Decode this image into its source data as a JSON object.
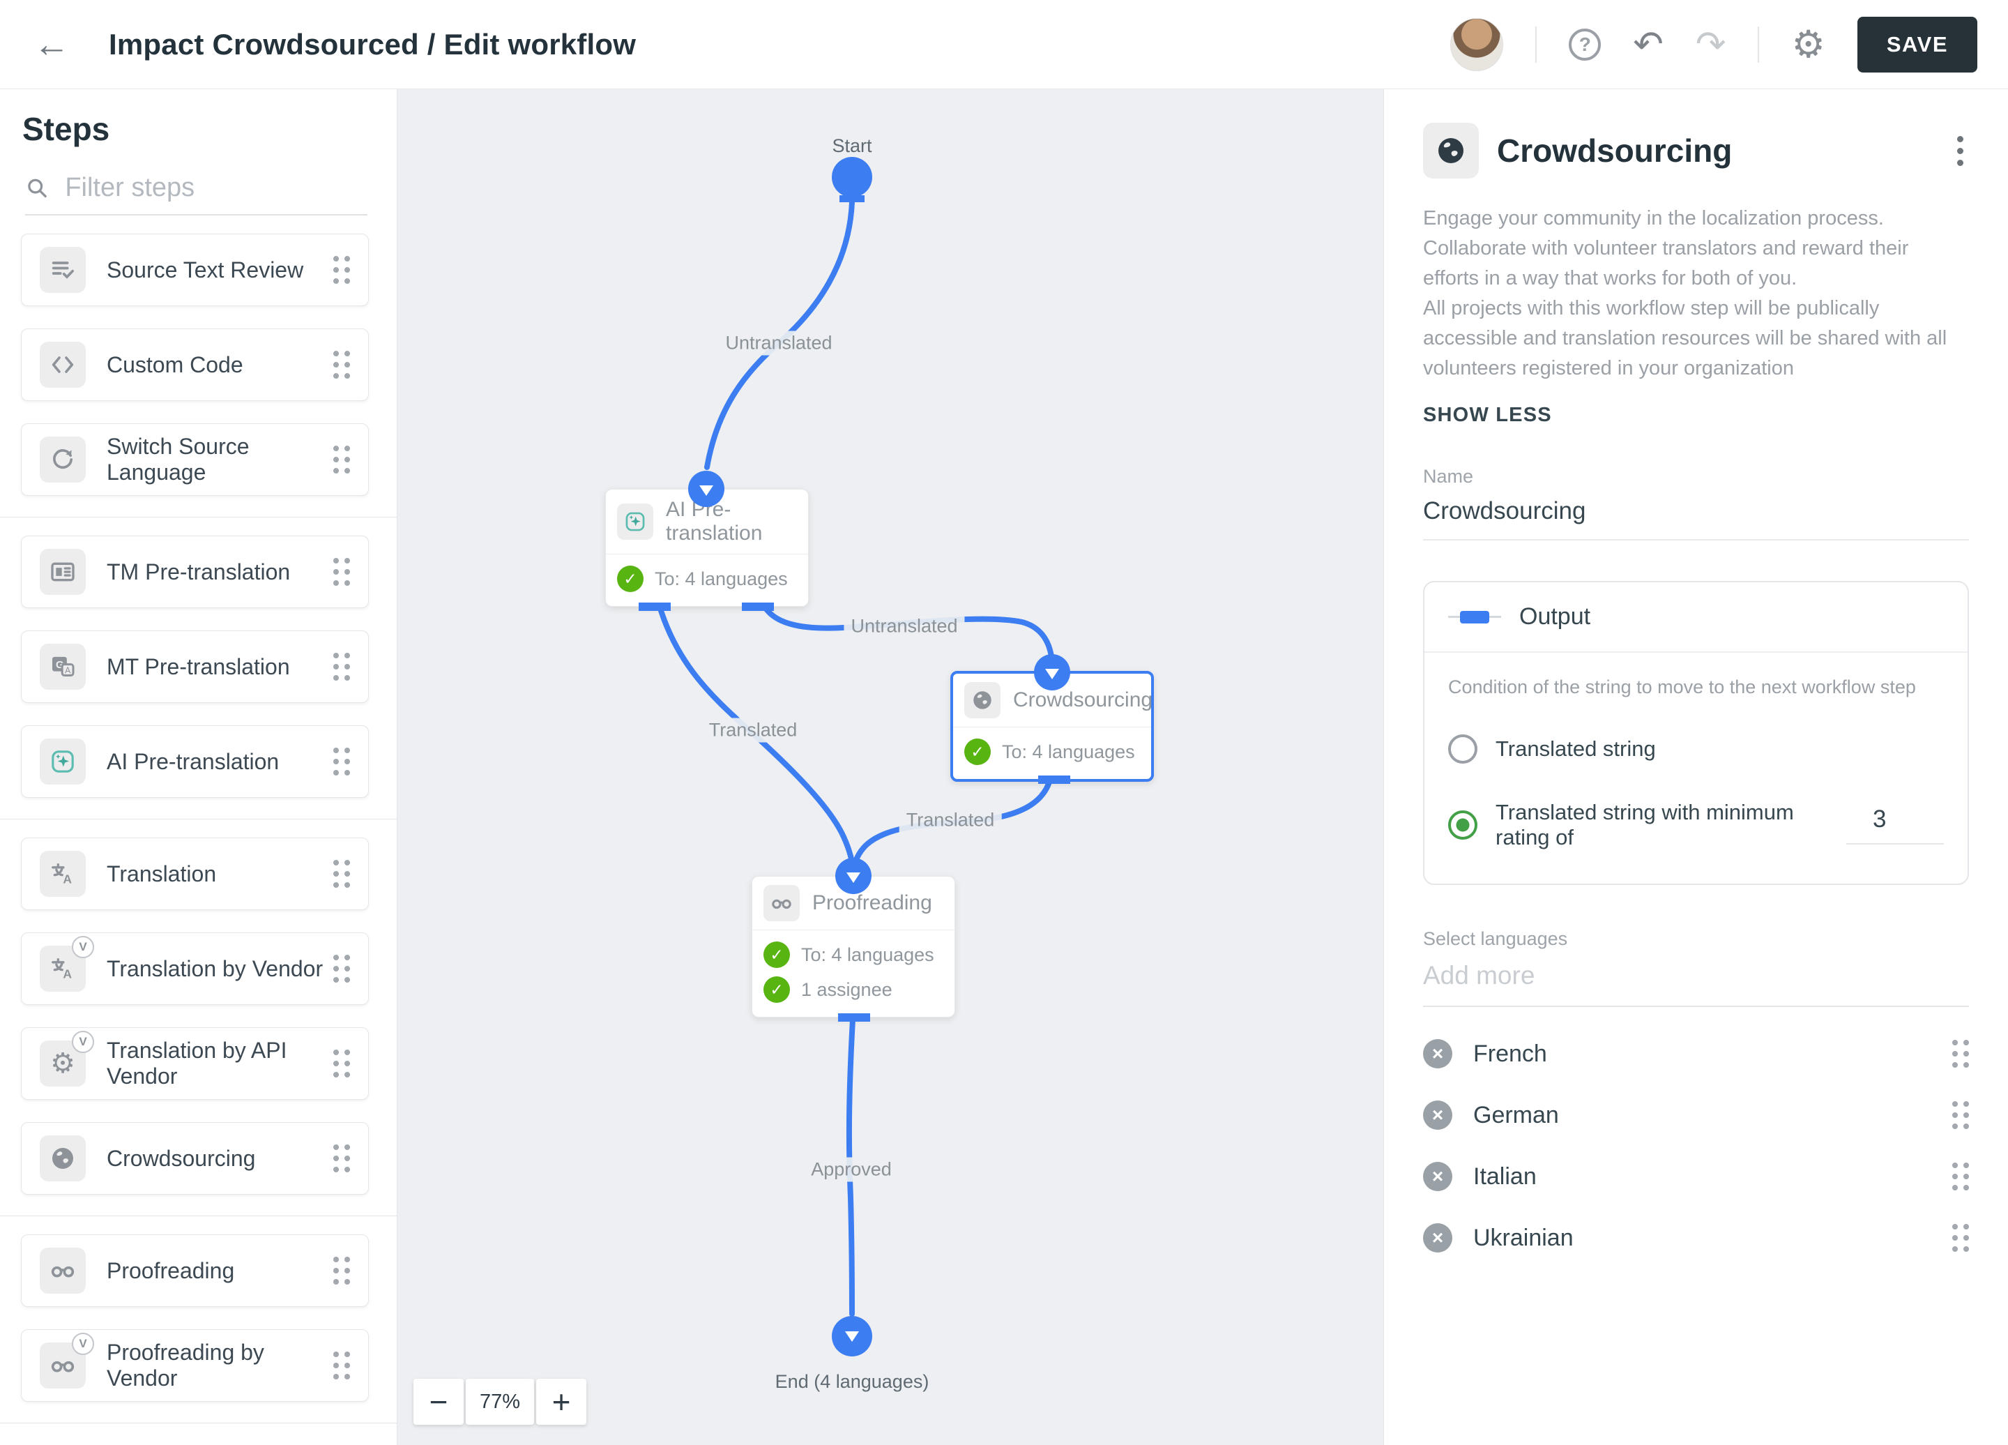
{
  "header": {
    "title": "Impact Crowdsourced / Edit workflow",
    "save_label": "SAVE"
  },
  "sidebar": {
    "title": "Steps",
    "filter_placeholder": "Filter steps",
    "groups": [
      {
        "items": [
          {
            "label": "Source Text Review",
            "icon": "list-check-icon"
          },
          {
            "label": "Custom Code",
            "icon": "code-icon"
          },
          {
            "label": "Switch Source Language",
            "icon": "sync-icon"
          }
        ]
      },
      {
        "items": [
          {
            "label": "TM Pre-translation",
            "icon": "tm-icon"
          },
          {
            "label": "MT Pre-translation",
            "icon": "mt-icon"
          },
          {
            "label": "AI Pre-translation",
            "icon": "ai-sparkle-icon"
          }
        ]
      },
      {
        "items": [
          {
            "label": "Translation",
            "icon": "translate-icon"
          },
          {
            "label": "Translation by Vendor",
            "icon": "translate-icon",
            "badge": "V"
          },
          {
            "label": "Translation by API Vendor",
            "icon": "gear-icon",
            "badge": "V"
          },
          {
            "label": "Crowdsourcing",
            "icon": "globe-icon"
          }
        ]
      },
      {
        "items": [
          {
            "label": "Proofreading",
            "icon": "glasses-icon"
          },
          {
            "label": "Proofreading by Vendor",
            "icon": "glasses-icon",
            "badge": "V"
          }
        ]
      }
    ]
  },
  "canvas": {
    "zoom": "77%",
    "start_label": "Start",
    "end_label": "End (4 languages)",
    "edge_labels": [
      "Untranslated",
      "Untranslated",
      "Translated",
      "Translated",
      "Approved"
    ],
    "nodes": [
      {
        "title": "AI Pre-translation",
        "badges": [
          "To: 4 languages"
        ]
      },
      {
        "title": "Crowdsourcing",
        "badges": [
          "To: 4 languages"
        ]
      },
      {
        "title": "Proofreading",
        "badges": [
          "To: 4 languages",
          "1 assignee"
        ]
      }
    ],
    "accent_color": "#3c7df1"
  },
  "panel": {
    "title": "Crowdsourcing",
    "description1": "Engage your community in the localization process. Collaborate with volunteer translators and reward their efforts in a way that works for both of you.",
    "description2": "All projects with this workflow step will be publically accessible and translation resources will be shared with all volunteers registered in your organization",
    "show_less": "SHOW LESS",
    "name_label": "Name",
    "name_value": "Crowdsourcing",
    "output": {
      "title": "Output",
      "condition_label": "Condition of the string to move to the next workflow step",
      "options": [
        {
          "label": "Translated string",
          "selected": false
        },
        {
          "label": "Translated string with minimum rating of",
          "selected": true,
          "value": "3"
        }
      ]
    },
    "languages": {
      "label": "Select languages",
      "placeholder": "Add more",
      "items": [
        "French",
        "German",
        "Italian",
        "Ukrainian"
      ]
    },
    "status_green": "#58b411",
    "radio_green": "#43a047"
  }
}
